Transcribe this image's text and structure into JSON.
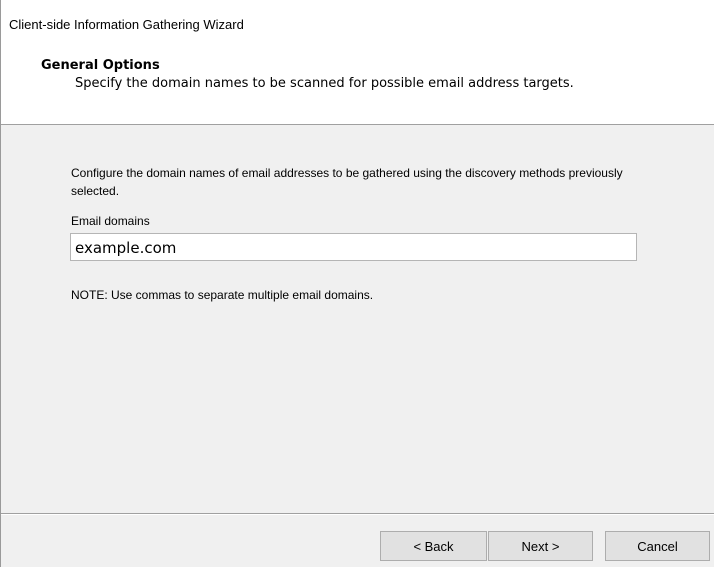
{
  "window": {
    "title": "Client-side Information Gathering Wizard"
  },
  "header": {
    "title": "General Options",
    "description": "Specify the domain names to be scanned for possible email address targets."
  },
  "content": {
    "intro": "Configure the domain names of email addresses to be gathered using the discovery methods previously selected.",
    "email_domains_label": "Email domains",
    "email_domains_value": "example.com",
    "note": "NOTE: Use commas to separate multiple email domains."
  },
  "buttons": {
    "back": "< Back",
    "next": "Next >",
    "cancel": "Cancel"
  }
}
